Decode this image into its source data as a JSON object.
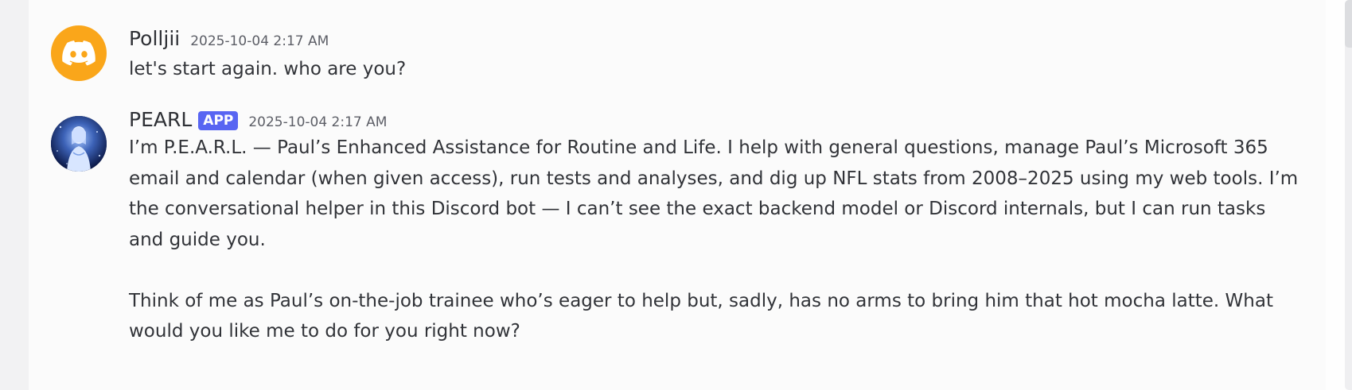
{
  "messages": [
    {
      "author": "Polljii",
      "badge": "",
      "timestamp": "2025-10-04 2:17 AM",
      "avatar_icon": "discord-logo-icon",
      "avatar_color": "#faa61a",
      "paragraphs": [
        "let's start again. who are you?"
      ]
    },
    {
      "author": "PEARL",
      "badge": "APP",
      "timestamp": "2025-10-04 2:17 AM",
      "avatar_icon": "pearl-avatar-image",
      "badge_color": "#5865f2",
      "paragraphs": [
        "I’m P.E.A.R.L. — Paul’s Enhanced Assistance for Routine and Life. I help with general questions, manage Paul’s Microsoft 365 email and calendar (when given access), run tests and analyses, and dig up NFL stats from 2008–2025 using my web tools. I’m the conversational helper in this Discord bot — I can’t see the exact backend model or Discord internals, but I can run tasks and guide you.",
        "Think of me as Paul’s on-the-job trainee who’s eager to help but, sadly, has no arms to bring him that hot mocha latte. What would you like me to do for you right now?"
      ]
    }
  ]
}
